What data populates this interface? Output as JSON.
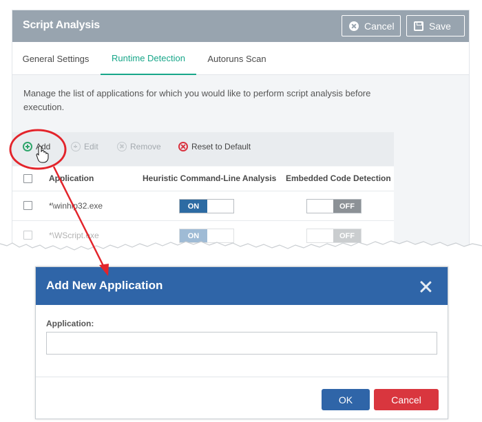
{
  "panel": {
    "title": "Script Analysis",
    "cancel_label": "Cancel",
    "save_label": "Save",
    "tabs": [
      {
        "label": "General Settings",
        "active": false
      },
      {
        "label": "Runtime Detection",
        "active": true
      },
      {
        "label": "Autoruns Scan",
        "active": false
      }
    ],
    "description": "Manage the list of applications for which you would like to perform script analysis before execution.",
    "toolbar": {
      "add": "Add",
      "edit": "Edit",
      "remove": "Remove",
      "reset": "Reset to Default"
    },
    "table": {
      "headers": [
        "Application",
        "Heuristic Command-Line Analysis",
        "Embedded Code Detection"
      ],
      "rows": [
        {
          "application": "*\\winhlp32.exe",
          "heuristic": "ON",
          "embedded": "OFF"
        },
        {
          "application": "*\\WScript.exe",
          "heuristic": "ON",
          "embedded": "OFF"
        }
      ]
    }
  },
  "dialog": {
    "title": "Add New Application",
    "field_label": "Application:",
    "field_value": "",
    "ok_label": "OK",
    "cancel_label": "Cancel"
  },
  "colors": {
    "header_grey": "#98a4af",
    "tab_active": "#17a689",
    "dialog_blue": "#2f65a8",
    "cancel_red": "#d9363e",
    "annotation_red": "#e3242b"
  }
}
